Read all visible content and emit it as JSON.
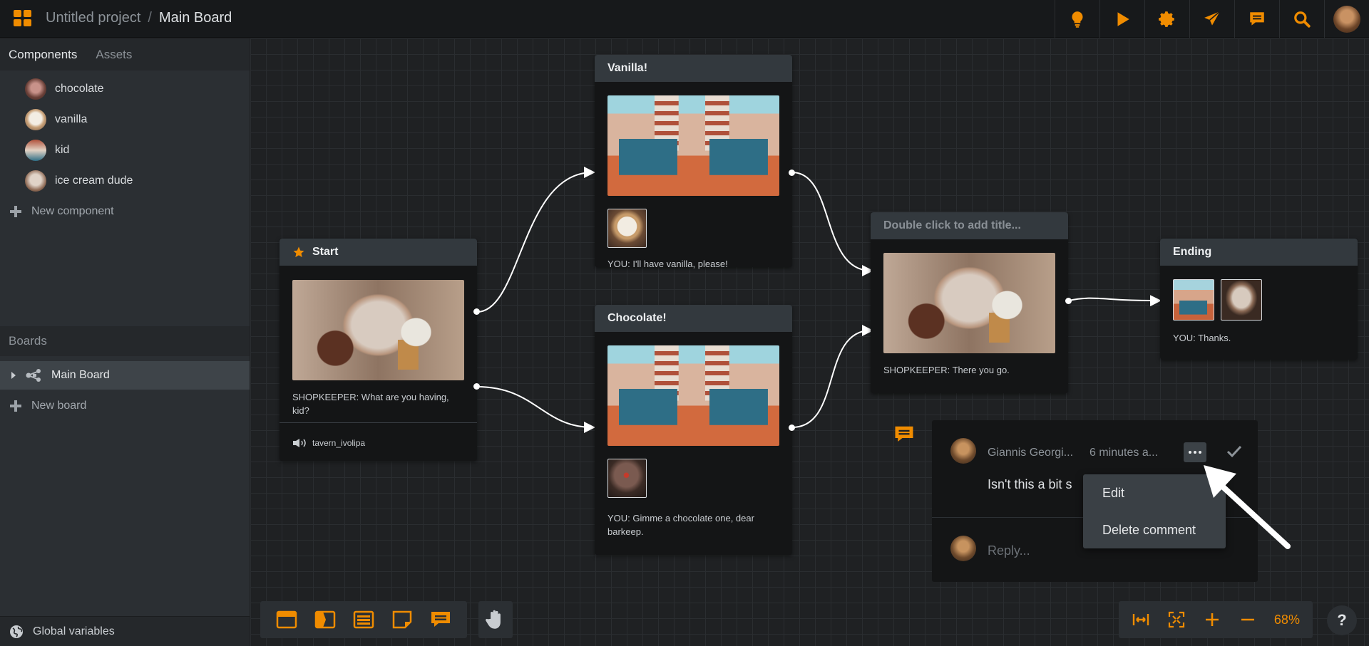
{
  "topbar": {
    "project": "Untitled project",
    "separator": "/",
    "board": "Main Board",
    "buttons": [
      "lightbulb-icon",
      "play-icon",
      "gear-icon",
      "send-icon",
      "comment-icon",
      "search-icon",
      "avatar"
    ]
  },
  "sidebar": {
    "tabs": [
      "Components",
      "Assets"
    ],
    "components": [
      {
        "label": "chocolate"
      },
      {
        "label": "vanilla"
      },
      {
        "label": "kid"
      },
      {
        "label": "ice cream dude"
      }
    ],
    "new_component": "New component",
    "boards_header": "Boards",
    "boards": [
      {
        "label": "Main Board"
      }
    ],
    "new_board": "New board",
    "global_variables": "Global variables"
  },
  "nodes": {
    "start": {
      "title": "Start",
      "text": "SHOPKEEPER: What are you having, kid?",
      "sound": "tavern_ivolipa"
    },
    "vanilla": {
      "title": "Vanilla!",
      "text": "YOU: I'll have vanilla, please!"
    },
    "chocolate": {
      "title": "Chocolate!",
      "text": "YOU: Gimme a chocolate one, dear barkeep."
    },
    "middle": {
      "title": "Double click to add title...",
      "text": "SHOPKEEPER: There you go."
    },
    "ending": {
      "title": "Ending",
      "text": "YOU: Thanks."
    }
  },
  "comment": {
    "author": "Giannis Georgi...",
    "time": "6 minutes a...",
    "body": "Isn't this a bit s",
    "reply_placeholder": "Reply...",
    "menu": [
      "Edit",
      "Delete comment"
    ]
  },
  "toolbar": {
    "tools": [
      "card-icon",
      "tag-icon",
      "list-icon",
      "note-icon",
      "comment-icon"
    ],
    "zoom": "68%",
    "help": "?"
  },
  "colors": {
    "accent": "#f08c00",
    "background": "#1f2123",
    "node_header": "#33393e"
  }
}
